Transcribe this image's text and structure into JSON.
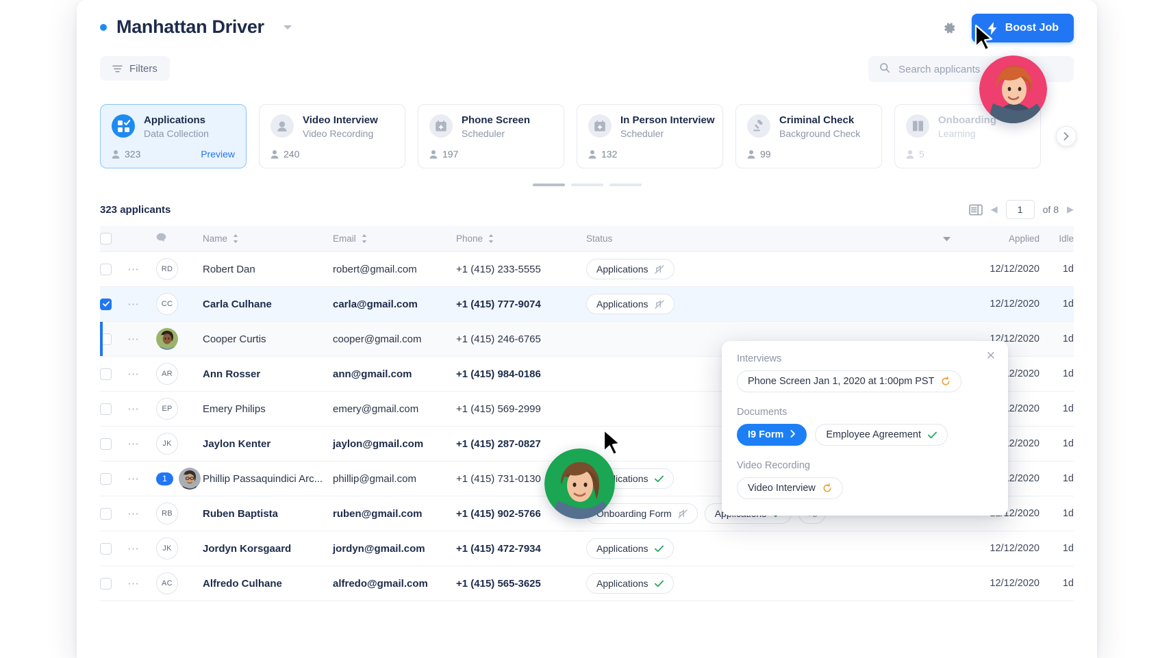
{
  "header": {
    "job_title": "Manhattan Driver",
    "status_dot_color": "#1d8bf1",
    "settings_icon": "gear-icon",
    "dropdown_icon": "chevron-down-icon",
    "boost_label": "Boost Job",
    "boost_icon": "bolt-icon",
    "boost_color": "#2176f3"
  },
  "subbar": {
    "filters_label": "Filters",
    "filters_icon": "filter-icon",
    "search_icon": "search-icon",
    "search_placeholder": "Search applicants",
    "search_value": ""
  },
  "stages": [
    {
      "name": "Applications",
      "type": "Data Collection",
      "count": "323",
      "icon": "grid-check-icon",
      "active": true,
      "dim": false,
      "action": "Preview"
    },
    {
      "name": "Video Interview",
      "type": "Video Recording",
      "count": "240",
      "icon": "video-person-icon",
      "active": false,
      "dim": false,
      "action": ""
    },
    {
      "name": "Phone Screen",
      "type": "Scheduler",
      "count": "197",
      "icon": "calendar-plus-icon",
      "active": false,
      "dim": false,
      "action": ""
    },
    {
      "name": "In Person Interview",
      "type": "Scheduler",
      "count": "132",
      "icon": "calendar-plus-icon",
      "active": false,
      "dim": false,
      "action": ""
    },
    {
      "name": "Criminal Check",
      "type": "Background Check",
      "count": "99",
      "icon": "gavel-icon",
      "active": false,
      "dim": false,
      "action": ""
    },
    {
      "name": "Onboarding",
      "type": "Learning",
      "count": "5",
      "icon": "book-icon",
      "active": false,
      "dim": true,
      "action": ""
    }
  ],
  "carousel": {
    "next_icon": "chevron-right-icon",
    "dots": [
      true,
      false,
      false
    ]
  },
  "list_meta": {
    "applicants_count": "323 applicants",
    "view_icon": "list-view-icon",
    "prev_icon": "chevron-left-icon",
    "next_icon": "chevron-right-icon",
    "page_value": "1",
    "page_total": "of 8"
  },
  "table": {
    "columns": {
      "note": "note-icon",
      "name": "Name",
      "email": "Email",
      "phone": "Phone",
      "status": "Status",
      "applied": "Applied",
      "idle": "Idle"
    },
    "rows": [
      {
        "checked": false,
        "selected": false,
        "highlight": false,
        "bold": false,
        "badge": "",
        "avatar_type": "initials",
        "initials": "RD",
        "name": "Robert Dan",
        "email": "robert@gmail.com",
        "phone": "+1 (415) 233-5555",
        "applied": "12/12/2020",
        "idle": "1d",
        "chips": [
          {
            "label": "Applications",
            "icon": "mute-icon"
          }
        ]
      },
      {
        "checked": true,
        "selected": true,
        "highlight": false,
        "bold": true,
        "badge": "",
        "avatar_type": "initials",
        "initials": "CC",
        "name": "Carla Culhane",
        "email": "carla@gmail.com",
        "phone": "+1 (415) 777-9074",
        "applied": "12/12/2020",
        "idle": "1d",
        "chips": [
          {
            "label": "Applications",
            "icon": "mute-icon"
          }
        ]
      },
      {
        "checked": false,
        "selected": false,
        "highlight": true,
        "bold": false,
        "badge": "",
        "avatar_type": "photo",
        "initials": "",
        "name": "Cooper Curtis",
        "email": "cooper@gmail.com",
        "phone": "+1 (415) 246-6765",
        "applied": "12/12/2020",
        "idle": "1d",
        "chips": []
      },
      {
        "checked": false,
        "selected": false,
        "highlight": false,
        "bold": true,
        "badge": "",
        "avatar_type": "initials",
        "initials": "AR",
        "name": "Ann Rosser",
        "email": "ann@gmail.com",
        "phone": "+1 (415) 984-0186",
        "applied": "12/12/2020",
        "idle": "1d",
        "chips": []
      },
      {
        "checked": false,
        "selected": false,
        "highlight": false,
        "bold": false,
        "badge": "",
        "avatar_type": "initials",
        "initials": "EP",
        "name": "Emery Philips",
        "email": "emery@gmail.com",
        "phone": "+1 (415) 569-2999",
        "applied": "12/12/2020",
        "idle": "1d",
        "chips": []
      },
      {
        "checked": false,
        "selected": false,
        "highlight": false,
        "bold": true,
        "badge": "",
        "avatar_type": "initials",
        "initials": "JK",
        "name": "Jaylon Kenter",
        "email": "jaylon@gmail.com",
        "phone": "+1 (415) 287-0827",
        "applied": "12/12/2020",
        "idle": "1d",
        "chips": []
      },
      {
        "checked": false,
        "selected": false,
        "highlight": false,
        "bold": false,
        "badge": "1",
        "avatar_type": "photo",
        "initials": "",
        "name": "Phillip Passaquindici Arc...",
        "email": "phillip@gmail.com",
        "phone": "+1 (415) 731-0130",
        "applied": "12/12/2020",
        "idle": "1d",
        "chips": [
          {
            "label": "Applications",
            "icon": "check-icon"
          }
        ]
      },
      {
        "checked": false,
        "selected": false,
        "highlight": false,
        "bold": true,
        "badge": "",
        "avatar_type": "initials",
        "initials": "RB",
        "name": "Ruben Baptista",
        "email": "ruben@gmail.com",
        "phone": "+1 (415) 902-5766",
        "applied": "12/12/2020",
        "idle": "1d",
        "chips": [
          {
            "label": "Onboarding Form",
            "icon": "mute-icon"
          },
          {
            "label": "Applications",
            "icon": "check-icon"
          },
          {
            "label": "+3",
            "icon": "none"
          }
        ]
      },
      {
        "checked": false,
        "selected": false,
        "highlight": false,
        "bold": true,
        "badge": "",
        "avatar_type": "initials",
        "initials": "JK",
        "name": "Jordyn Korsgaard",
        "email": "jordyn@gmail.com",
        "phone": "+1 (415) 472-7934",
        "applied": "12/12/2020",
        "idle": "1d",
        "chips": [
          {
            "label": "Applications",
            "icon": "check-icon"
          }
        ]
      },
      {
        "checked": false,
        "selected": false,
        "highlight": false,
        "bold": true,
        "badge": "",
        "avatar_type": "initials",
        "initials": "AC",
        "name": "Alfredo Culhane",
        "email": "alfredo@gmail.com",
        "phone": "+1 (415) 565-3625",
        "applied": "12/12/2020",
        "idle": "1d",
        "chips": [
          {
            "label": "Applications",
            "icon": "check-icon"
          }
        ]
      }
    ]
  },
  "popover": {
    "close_icon": "close-icon",
    "interviews_label": "Interviews",
    "interview_pill": "Phone Screen Jan 1, 2020 at 1:00pm PST",
    "interview_pill_icon": "pending-icon",
    "documents_label": "Documents",
    "doc_primary": "I9 Form",
    "doc_primary_icon": "chevron-right-icon",
    "doc_secondary": "Employee Agreement",
    "doc_secondary_icon": "check-icon",
    "video_label": "Video Recording",
    "video_pill": "Video Interview",
    "video_pill_icon": "pending-icon"
  },
  "overlay": {
    "bubble_pink": "participant-video-bubble",
    "bubble_green": "participant-video-bubble",
    "cursor_1": "remote-cursor",
    "cursor_2": "remote-cursor"
  }
}
